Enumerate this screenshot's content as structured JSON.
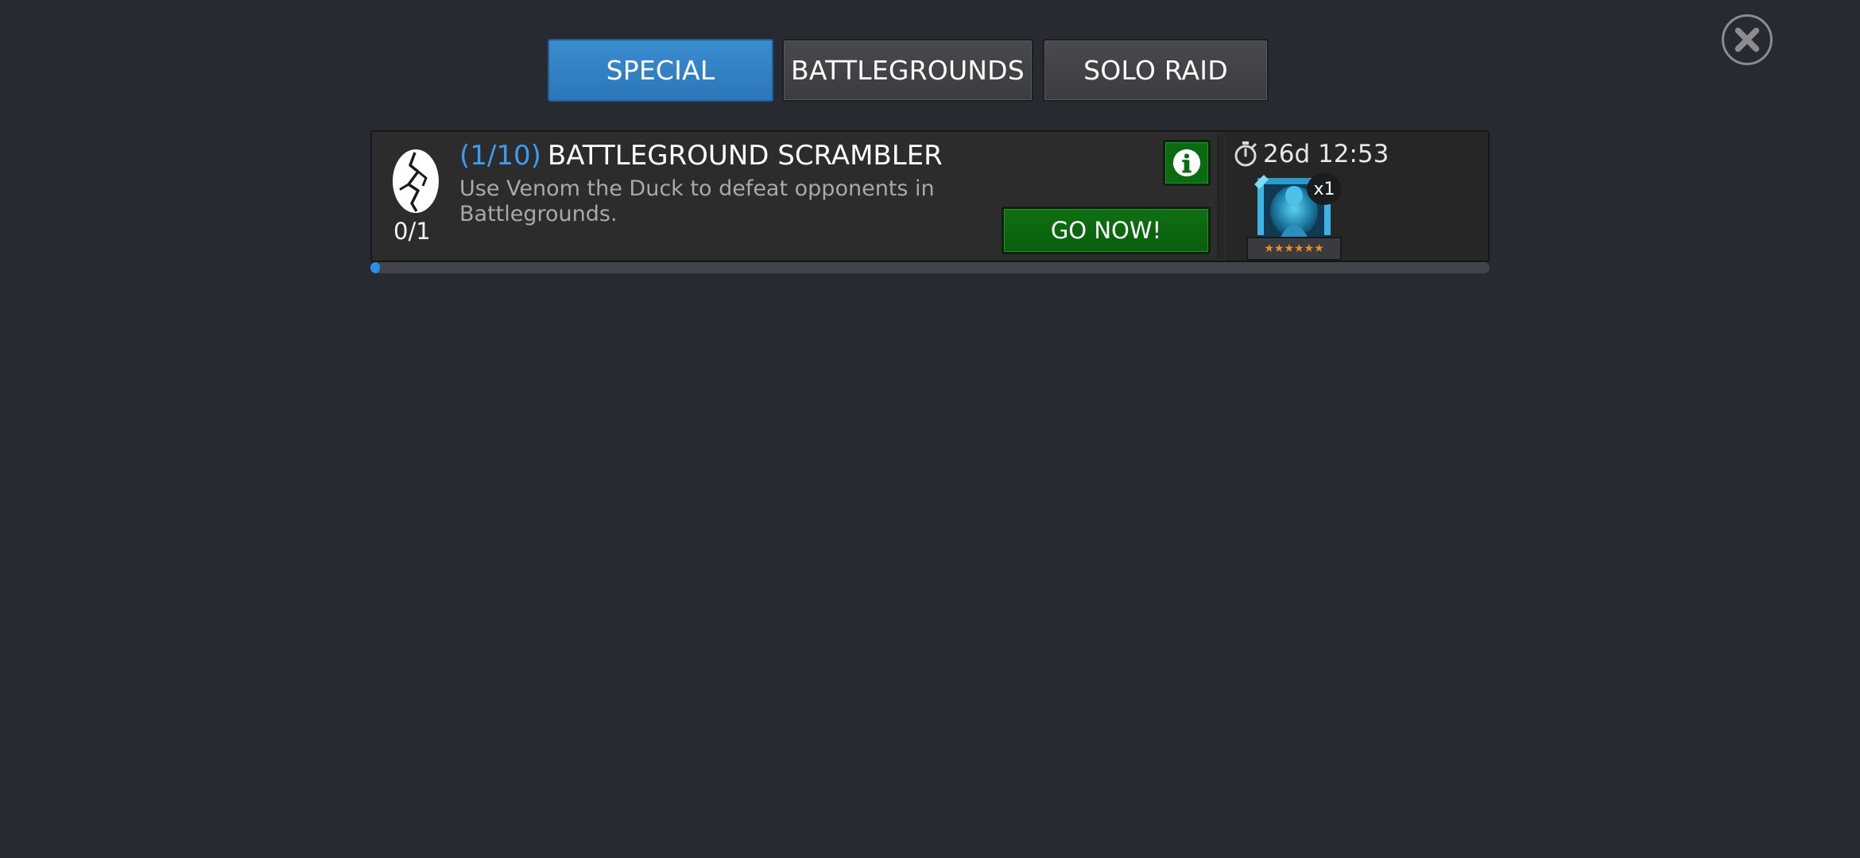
{
  "tabs": [
    {
      "label": "SPECIAL",
      "active": true
    },
    {
      "label": "BATTLEGROUNDS",
      "active": false
    },
    {
      "label": "SOLO RAID",
      "active": false
    }
  ],
  "close": {
    "icon": "close-icon"
  },
  "quest": {
    "icon": "cracked-egg-icon",
    "step": "(1/10)",
    "title": "BATTLEGROUND SCRAMBLER",
    "description": "Use Venom the Duck to defeat opponents in Battlegrounds.",
    "count": "0/1",
    "info_icon": "info-icon",
    "go_label": "GO NOW!",
    "timer_icon": "stopwatch-icon",
    "timer": "26d 12:53",
    "reward": {
      "icon": "crystal-icon",
      "quantity": "x1",
      "stars": "★★★★★★",
      "star_count": 6
    },
    "progress_fraction": 0.0
  },
  "colors": {
    "background": "#272a30",
    "active_tab": "#2b76b8",
    "accent_blue": "#3d9bf0",
    "go_green": "#095e0c",
    "star_orange": "#e8912a"
  }
}
